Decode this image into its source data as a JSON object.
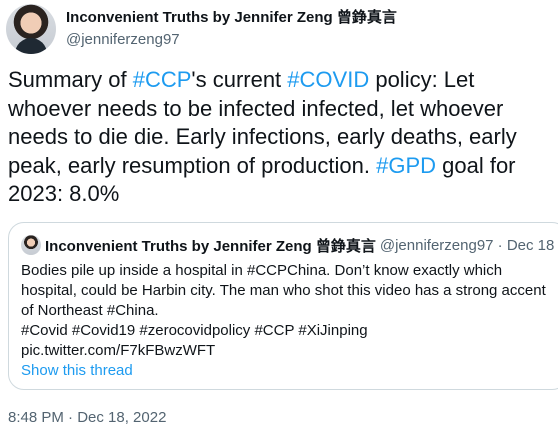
{
  "author": {
    "display_name": "Inconvenient Truths by Jennifer Zeng 曾錚真言",
    "handle": "@jenniferzeng97"
  },
  "tweet": {
    "segments": [
      {
        "text": "Summary of ",
        "hashtag": false
      },
      {
        "text": "#CCP",
        "hashtag": true
      },
      {
        "text": "'s current ",
        "hashtag": false
      },
      {
        "text": "#COVID",
        "hashtag": true
      },
      {
        "text": " policy: Let whoever needs to be infected infected, let whoever needs to die die. Early infections, early deaths, early peak, early resumption of production. ",
        "hashtag": false
      },
      {
        "text": "#GPD",
        "hashtag": true
      },
      {
        "text": " goal for 2023: 8.0%",
        "hashtag": false
      }
    ],
    "timestamp": "8:48 PM · Dec 18, 2022"
  },
  "quote": {
    "display_name": "Inconvenient Truths by Jennifer Zeng 曾錚真言",
    "meta": "@jenniferzeng97 · Dec 18",
    "lines": [
      "Bodies pile up inside a hospital in #CCPChina. Don’t know exactly which",
      "hospital, could be Harbin city. The man who shot this video has a strong accent",
      "of Northeast #China.",
      "#Covid #Covid19 #zerocovidpolicy #CCP #XiJinping",
      "pic.twitter.com/F7kFBwzWFT"
    ],
    "show_thread": "Show this thread"
  },
  "colors": {
    "accent": "#1d9bf0",
    "text": "#0f1419",
    "muted": "#536471",
    "border": "#cfd9de"
  }
}
